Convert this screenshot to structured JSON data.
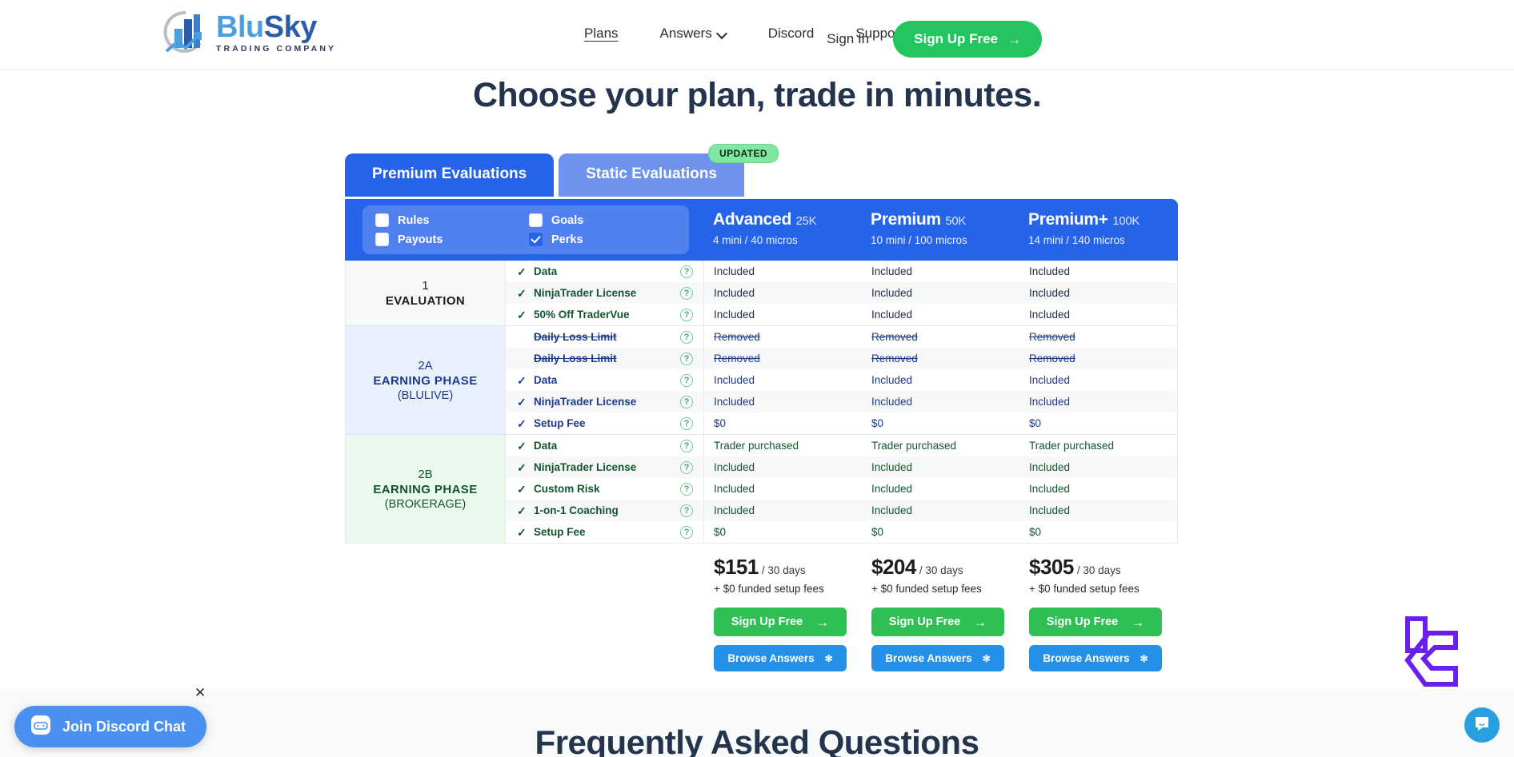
{
  "header": {
    "logo": {
      "name_part1": "Blu",
      "name_part2": "Sky",
      "tagline": "TRADING COMPANY"
    },
    "nav": [
      {
        "label": "Plans",
        "icon": "",
        "active": true
      },
      {
        "label": "Answers",
        "icon": "chevron-down-icon",
        "active": false
      },
      {
        "label": "Discord",
        "icon": "",
        "active": false
      },
      {
        "label": "Support",
        "icon": "",
        "active": false
      }
    ],
    "sign_in_label": "Sign In",
    "sign_up_label": "Sign Up Free",
    "sign_up_arrow": "→"
  },
  "page_title": "Choose your plan, trade in minutes.",
  "tabs": {
    "active_tab": "Premium Evaluations",
    "inactive_tab": "Static Evaluations",
    "badge": "UPDATED"
  },
  "filters": [
    {
      "label": "Rules",
      "checked": false
    },
    {
      "label": "Goals",
      "checked": false
    },
    {
      "label": "Payouts",
      "checked": false
    },
    {
      "label": "Perks",
      "checked": true
    }
  ],
  "plans": [
    {
      "name": "Advanced",
      "size": "25K",
      "contracts": "4 mini / 40 micros",
      "price": "$151",
      "period": "/ 30 days",
      "setup_fees": "+ $0 funded setup fees",
      "signup_label": "Sign Up Free",
      "browse_label": "Browse Answers"
    },
    {
      "name": "Premium",
      "size": "50K",
      "contracts": "10 mini / 100 micros",
      "price": "$204",
      "period": "/ 30 days",
      "setup_fees": "+ $0 funded setup fees",
      "signup_label": "Sign Up Free",
      "browse_label": "Browse Answers"
    },
    {
      "name": "Premium+",
      "size": "100K",
      "contracts": "14 mini / 140 micros",
      "price": "$305",
      "period": "/ 30 days",
      "setup_fees": "+ $0 funded setup fees",
      "signup_label": "Sign Up Free",
      "browse_label": "Browse Answers"
    }
  ],
  "phases": [
    {
      "num": "1",
      "name": "EVALUATION",
      "sub": "",
      "theme": "ph-eval",
      "rows": [
        {
          "feature": "Data",
          "state": "included",
          "values": [
            "Included",
            "Included",
            "Included"
          ]
        },
        {
          "feature": "NinjaTrader License",
          "state": "included",
          "values": [
            "Included",
            "Included",
            "Included"
          ]
        },
        {
          "feature": "50% Off TraderVue",
          "state": "included",
          "values": [
            "Included",
            "Included",
            "Included"
          ]
        }
      ]
    },
    {
      "num": "2A",
      "name": "EARNING PHASE",
      "sub": "(BLULIVE)",
      "theme": "ph-2a",
      "rows": [
        {
          "feature": "Daily Loss Limit",
          "state": "removed",
          "values": [
            "Removed",
            "Removed",
            "Removed"
          ]
        },
        {
          "feature": "Daily Loss Limit",
          "state": "removed",
          "values": [
            "Removed",
            "Removed",
            "Removed"
          ]
        },
        {
          "feature": "Data",
          "state": "included",
          "values": [
            "Included",
            "Included",
            "Included"
          ]
        },
        {
          "feature": "NinjaTrader License",
          "state": "included",
          "values": [
            "Included",
            "Included",
            "Included"
          ]
        },
        {
          "feature": "Setup Fee",
          "state": "included",
          "values": [
            "$0",
            "$0",
            "$0"
          ]
        }
      ]
    },
    {
      "num": "2B",
      "name": "EARNING PHASE",
      "sub": "(BROKERAGE)",
      "theme": "ph-2b",
      "rows": [
        {
          "feature": "Data",
          "state": "included",
          "values": [
            "Trader purchased",
            "Trader purchased",
            "Trader purchased"
          ]
        },
        {
          "feature": "NinjaTrader License",
          "state": "included",
          "values": [
            "Included",
            "Included",
            "Included"
          ]
        },
        {
          "feature": "Custom Risk",
          "state": "included",
          "values": [
            "Included",
            "Included",
            "Included"
          ]
        },
        {
          "feature": "1-on-1 Coaching",
          "state": "included",
          "values": [
            "Included",
            "Included",
            "Included"
          ]
        },
        {
          "feature": "Setup Fee",
          "state": "included",
          "values": [
            "$0",
            "$0",
            "$0"
          ]
        }
      ]
    }
  ],
  "faq_title": "Frequently Asked Questions",
  "widgets": {
    "discord_label": "Join Discord Chat",
    "discord_close": "✕",
    "intercom_icon": "chat-bubble-icon"
  },
  "colors": {
    "brand_blue": "#2563e8",
    "brand_light_blue": "#6e93ef",
    "green_cta": "#22c55e",
    "green_table_cta": "#2fbf55",
    "blue_browse": "#2490e8",
    "badge_green": "#7ee8a0",
    "discord_blue": "#4a90f0",
    "watermark_purple": "#6b1ef0"
  }
}
